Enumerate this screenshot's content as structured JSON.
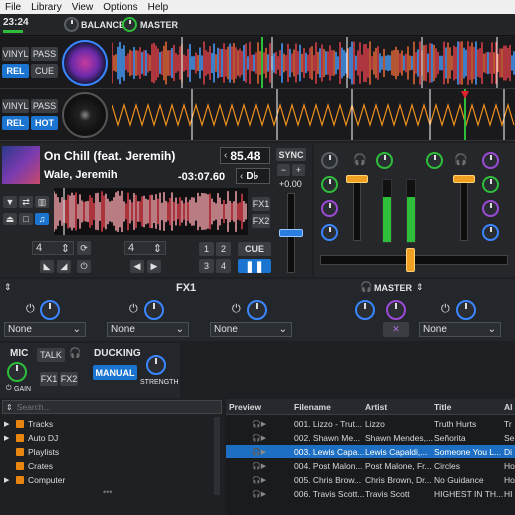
{
  "menu": [
    "File",
    "Library",
    "View",
    "Options",
    "Help"
  ],
  "header": {
    "clock": "23:24",
    "balance_label": "BALANCE",
    "master_label": "MASTER"
  },
  "deck_top": {
    "vinyl_label": "VINYL",
    "pass_label": "PASS",
    "rel_label": "REL",
    "cue_label": "CUE"
  },
  "deck_bottom": {
    "vinyl_label": "VINYL",
    "pass_label": "PASS",
    "rel_label": "REL",
    "hot_label": "HOT"
  },
  "track": {
    "title": "On Chill (feat. Jeremih)",
    "artist": "Wale, Jeremih",
    "bpm": "85.48",
    "time_remaining": "-03:07.60",
    "key": "D♭",
    "sync_label": "SYNC",
    "pitch": "+0.00",
    "fx1_label": "FX1",
    "fx2_label": "FX2",
    "loop_value_1": "4",
    "loop_value_2": "4",
    "hotcues": [
      "1",
      "2",
      "3",
      "4"
    ],
    "cue_label": "CUE",
    "pause_icon": "pause-icon"
  },
  "fx": {
    "title": "FX1",
    "master_label": "MASTER",
    "slots": [
      "None",
      "None",
      "None",
      "None"
    ]
  },
  "mic": {
    "mic_label": "MIC",
    "talk_label": "TALK",
    "gain_label": "GAIN",
    "fx1_label": "FX1",
    "fx2_label": "FX2",
    "ducking_label": "DUCKING",
    "manual_label": "MANUAL",
    "strength_label": "STRENGTH"
  },
  "library": {
    "search_placeholder": "Search...",
    "tree": [
      {
        "label": "Tracks",
        "expandable": true
      },
      {
        "label": "Auto DJ",
        "expandable": true
      },
      {
        "label": "Playlists",
        "expandable": false
      },
      {
        "label": "Crates",
        "expandable": false
      },
      {
        "label": "Computer",
        "expandable": true
      }
    ],
    "columns": [
      "Preview",
      "Filename",
      "Artist",
      "Title",
      "Al"
    ],
    "rows": [
      {
        "filename": "001. Lizzo - Trut...",
        "artist": "Lizzo",
        "title": "Truth Hurts",
        "al": "Tr",
        "selected": false
      },
      {
        "filename": "002. Shawn Me...",
        "artist": "Shawn Mendes,...",
        "title": "Señorita",
        "al": "Se",
        "selected": false
      },
      {
        "filename": "003. Lewis Capa...",
        "artist": "Lewis Capaldi,...",
        "title": "Someone You L...",
        "al": "Di",
        "selected": true
      },
      {
        "filename": "004. Post Malon...",
        "artist": "Post Malone, Fr...",
        "title": "Circles",
        "al": "Ho",
        "selected": false
      },
      {
        "filename": "005. Chris Brow...",
        "artist": "Chris Brown, Dr...",
        "title": "No Guidance",
        "al": "Ho",
        "selected": false
      },
      {
        "filename": "006. Travis Scott...",
        "artist": "Travis Scott",
        "title": "HIGHEST IN TH...",
        "al": "HI",
        "selected": false
      }
    ]
  },
  "colors": {
    "accent": "#1b75d0",
    "selected_row": "#1c6fc2",
    "wave_red": "#e0404a",
    "wave_orange": "#f09020",
    "meter_green": "#2fbe3a",
    "fader_orange": "#f0a020"
  }
}
